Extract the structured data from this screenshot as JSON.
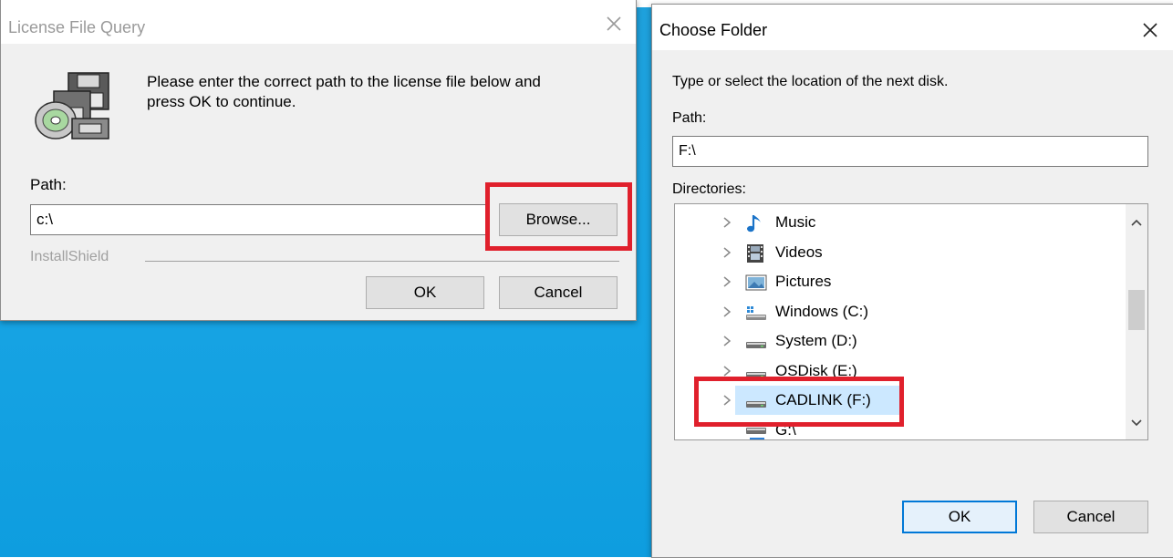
{
  "license_dialog": {
    "title": "License File Query",
    "message_line1": "Please enter the correct path to the license file below and",
    "message_line2": "press OK to continue.",
    "path_label": "Path:",
    "path_value": "c:\\",
    "browse_label": "Browse...",
    "brand_label": "InstallShield",
    "ok_label": "OK",
    "cancel_label": "Cancel",
    "icon": "cd-floppy-setup-icon"
  },
  "folder_dialog": {
    "title": "Choose Folder",
    "instruction": "Type or select the location of the next disk.",
    "path_label": "Path:",
    "path_value": "F:\\",
    "directories_label": "Directories:",
    "tree_items": [
      {
        "label": "Music",
        "icon": "music-icon"
      },
      {
        "label": "Videos",
        "icon": "videos-icon"
      },
      {
        "label": "Pictures",
        "icon": "pictures-icon"
      },
      {
        "label": "Windows (C:)",
        "icon": "windows-drive-icon"
      },
      {
        "label": "System (D:)",
        "icon": "drive-icon"
      },
      {
        "label": "OSDisk (E:)",
        "icon": "drive-icon"
      },
      {
        "label": "CADLINK (F:)",
        "icon": "drive-icon",
        "selected": true
      },
      {
        "label": "G:\\",
        "icon": "network-drive-icon"
      }
    ],
    "ok_label": "OK",
    "cancel_label": "Cancel"
  },
  "colors": {
    "desktop": "#16a3e3",
    "dialog_bg": "#f0f0f0",
    "highlight_box": "#e0202c",
    "selection": "#cce8ff",
    "default_button_border": "#0078d7"
  }
}
